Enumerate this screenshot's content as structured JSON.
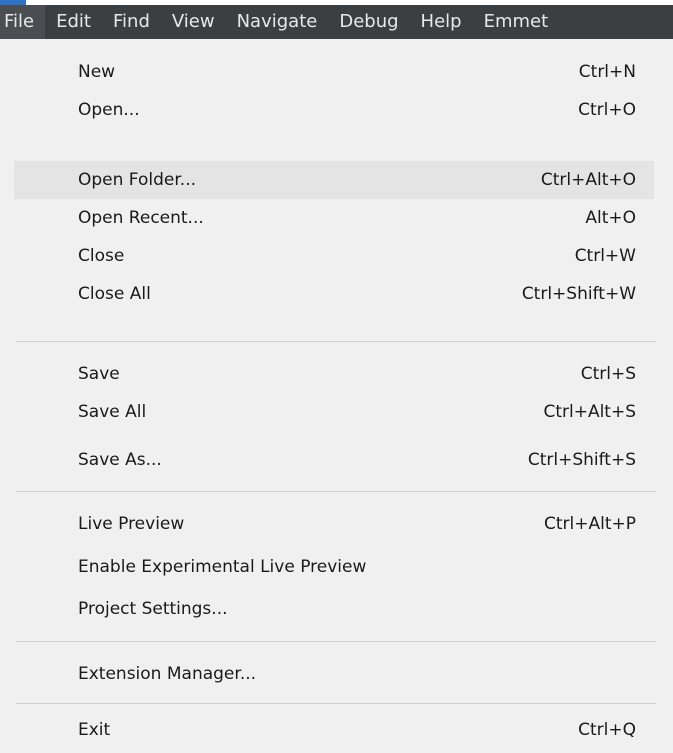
{
  "menubar": {
    "items": [
      "File",
      "Edit",
      "Find",
      "View",
      "Navigate",
      "Debug",
      "Help",
      "Emmet"
    ]
  },
  "file_menu": {
    "new": {
      "label": "New",
      "shortcut": "Ctrl+N"
    },
    "open": {
      "label": "Open...",
      "shortcut": "Ctrl+O"
    },
    "open_folder": {
      "label": "Open Folder...",
      "shortcut": "Ctrl+Alt+O"
    },
    "open_recent": {
      "label": "Open Recent...",
      "shortcut": "Alt+O"
    },
    "close": {
      "label": "Close",
      "shortcut": "Ctrl+W"
    },
    "close_all": {
      "label": "Close All",
      "shortcut": "Ctrl+Shift+W"
    },
    "save": {
      "label": "Save",
      "shortcut": "Ctrl+S"
    },
    "save_all": {
      "label": "Save All",
      "shortcut": "Ctrl+Alt+S"
    },
    "save_as": {
      "label": "Save As...",
      "shortcut": "Ctrl+Shift+S"
    },
    "live_preview": {
      "label": "Live Preview",
      "shortcut": "Ctrl+Alt+P"
    },
    "experimental_live_preview": {
      "label": "Enable Experimental Live Preview",
      "shortcut": ""
    },
    "project_settings": {
      "label": "Project Settings...",
      "shortcut": ""
    },
    "extension_manager": {
      "label": "Extension Manager...",
      "shortcut": ""
    },
    "exit": {
      "label": "Exit",
      "shortcut": "Ctrl+Q"
    }
  },
  "hovered_item": "Open Folder...",
  "colors": {
    "menubar_bg": "#3b3f42",
    "menu_bg": "#f0f0f0",
    "hover_bg": "#e4e4e4",
    "separator": "#d0d0d0"
  }
}
